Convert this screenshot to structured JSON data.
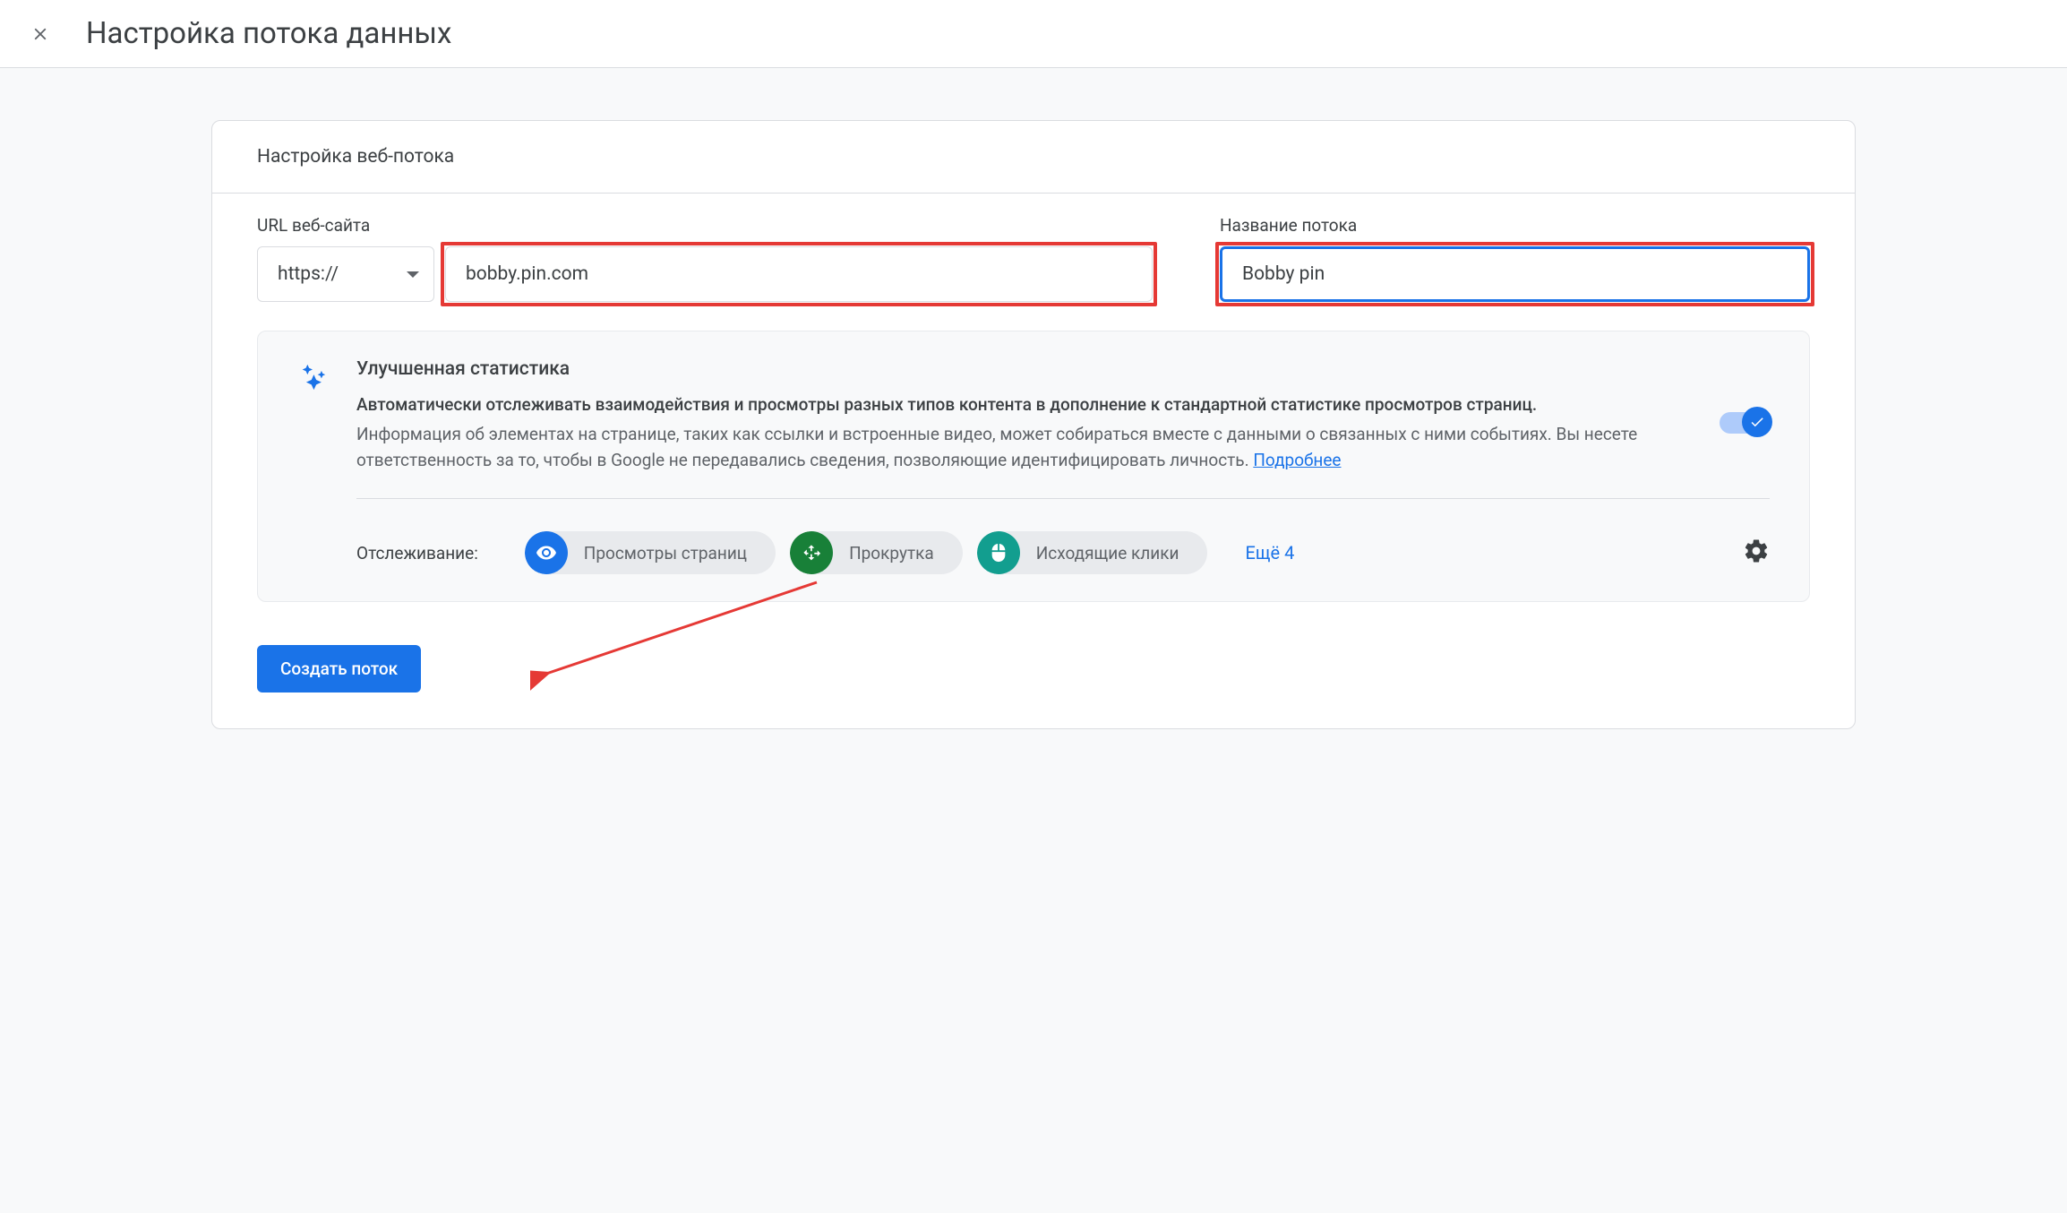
{
  "header": {
    "title": "Настройка потока данных"
  },
  "card": {
    "sectionTitle": "Настройка веб-потока"
  },
  "form": {
    "urlLabel": "URL веб-сайта",
    "scheme": "https://",
    "urlValue": "bobby.pin.com",
    "streamLabel": "Название потока",
    "streamValue": "Bobby pin"
  },
  "enhanced": {
    "title": "Улучшенная статистика",
    "bold": "Автоматически отслеживать взаимодействия и просмотры разных типов контента в дополнение к стандартной статистике просмотров страниц.",
    "desc": "Информация об элементах на странице, таких как ссылки и встроенные видео, может собираться вместе с данными о связанных с ними событиях. Вы несете ответственность за то, чтобы в Google не передавались сведения, позволяющие идентифицировать личность. ",
    "learnMore": "Подробнее"
  },
  "tracking": {
    "label": "Отслеживание:",
    "chips": [
      {
        "label": "Просмотры страниц"
      },
      {
        "label": "Прокрутка"
      },
      {
        "label": "Исходящие клики"
      }
    ],
    "more": "Ещё 4"
  },
  "submit": {
    "label": "Создать поток"
  }
}
